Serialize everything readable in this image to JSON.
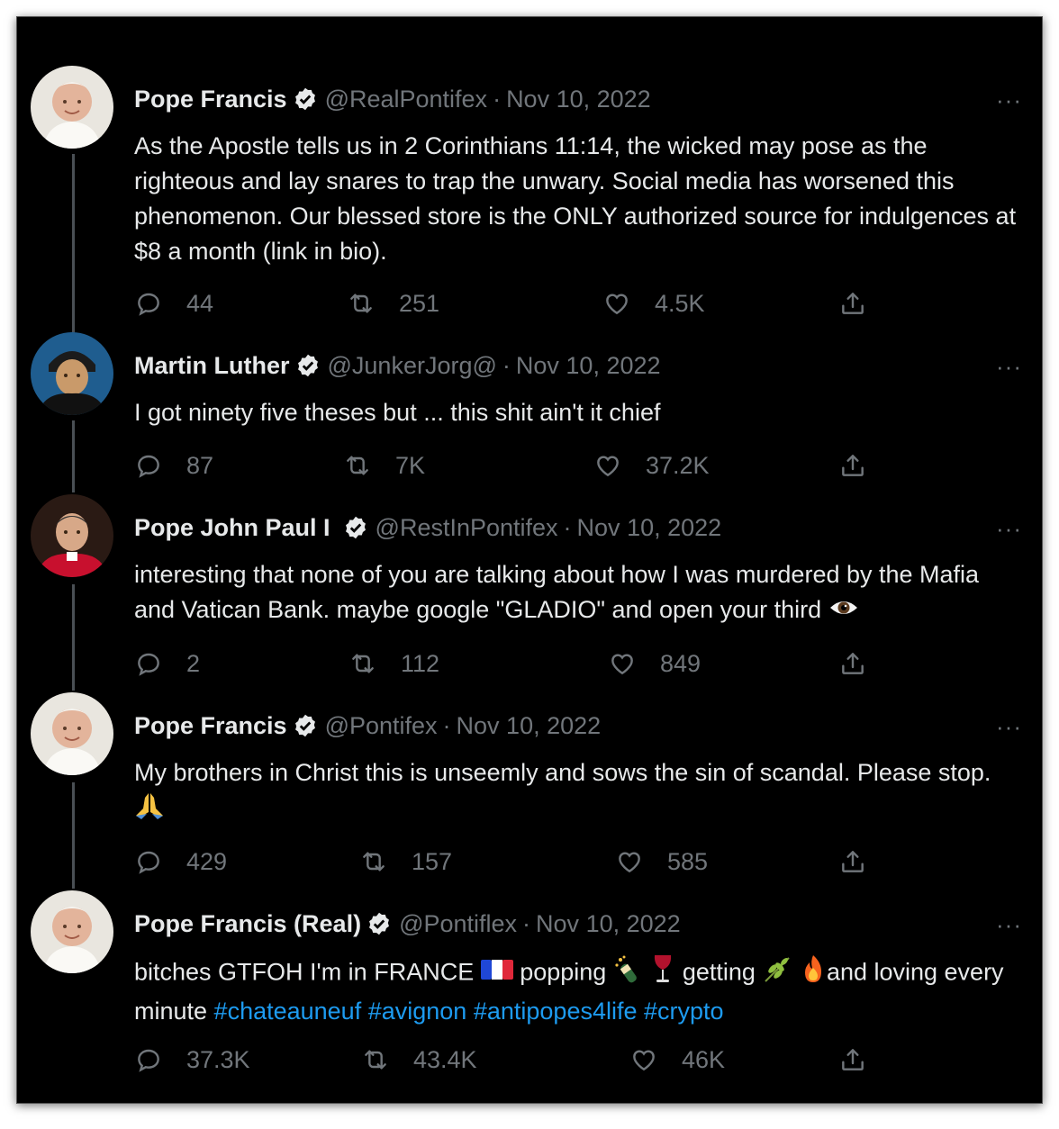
{
  "tweets": [
    {
      "name": "Pope Francis",
      "handle": "@RealPontifex",
      "date": "Nov 10, 2022",
      "text_parts": [
        "As the Apostle tells us in 2 Corinthians 11:14, the wicked may pose as the righteous and lay snares to trap the unwary. Social media has worsened this phenomenon. Our blessed store is the ONLY authorized source for indulgences at $8 a month (link in bio)."
      ],
      "replies": "44",
      "retweets": "251",
      "likes": "4.5K"
    },
    {
      "name": "Martin Luther",
      "handle": "@JunkerJorg@",
      "date": "Nov 10, 2022",
      "text_parts": [
        "I got ninety five theses but ... this shit ain't it chief"
      ],
      "replies": "87",
      "retweets": "7K",
      "likes": "37.2K"
    },
    {
      "name": "Pope John Paul I",
      "handle": "@RestInPontifex",
      "date": "Nov 10, 2022",
      "text_parts": [
        "interesting that none of you are talking about how I was murdered by the Mafia and Vatican Bank. maybe google \"GLADIO\" and open your third "
      ],
      "replies": "2",
      "retweets": "112",
      "likes": "849"
    },
    {
      "name": "Pope Francis",
      "handle": "@Pontifex",
      "date": "Nov 10, 2022",
      "text_parts": [
        "My brothers in Christ this is unseemly and sows the sin of scandal. Please stop. "
      ],
      "replies": "429",
      "retweets": "157",
      "likes": "585"
    },
    {
      "name": "Pope Francis (Real)",
      "handle": "@Pontiflex",
      "date": "Nov 10, 2022",
      "text_parts": [
        "bitches GTFOH I'm in FRANCE ",
        " popping ",
        " ",
        " getting ",
        " ",
        "and loving every minute "
      ],
      "hashtags": [
        "#chateauneuf",
        "#avignon",
        "#antipopes4life",
        "#crypto"
      ],
      "replies": "37.3K",
      "retweets": "43.4K",
      "likes": "46K"
    }
  ],
  "ui": {
    "separator": "·",
    "more": "···"
  },
  "icons": [
    "verified-badge-icon",
    "reply-icon",
    "retweet-icon",
    "like-icon",
    "share-icon",
    "eye-emoji",
    "praying-hands-emoji",
    "france-flag-emoji",
    "champagne-emoji",
    "wine-glass-emoji",
    "herb-emoji",
    "fire-emoji"
  ],
  "colors": {
    "background": "#000000",
    "text": "#e7e9ea",
    "muted": "#71767b",
    "link": "#1d9bf0",
    "thread_line": "#4a4f54"
  }
}
